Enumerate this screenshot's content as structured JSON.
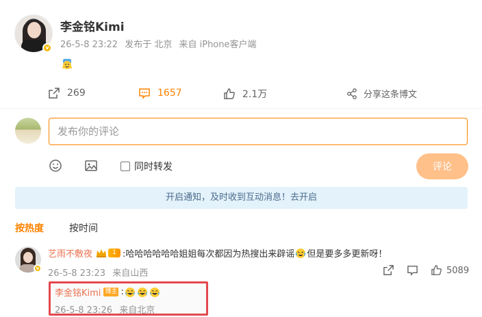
{
  "post": {
    "author": "李金铭Kimi",
    "time": "26-5-8 23:22",
    "location": "发布于 北京",
    "source": "来自 iPhone客户端"
  },
  "actions": {
    "repost_count": "269",
    "comment_count": "1657",
    "like_count": "2.1万",
    "share_label": "分享这条博文"
  },
  "composer": {
    "placeholder": "发布你的评论",
    "repost_label": "同时转发",
    "submit_label": "评论"
  },
  "notice": "开启通知，及时收到互动消息！去开启",
  "sort_tabs": [
    "按热度",
    "按时间"
  ],
  "comment": {
    "user": "艺雨不敷夜",
    "level": "1",
    "text_part1": ":哈哈哈哈哈哈姐姐每次都因为热搜出来辟谣",
    "text_part2": "但是要多多更新呀！",
    "time": "26-5-8 23:23",
    "source": "来自山西",
    "like_count": "5089"
  },
  "reply": {
    "user": "李金铭Kimi",
    "badge": "博主",
    "colon": ":",
    "time": "26-5-8 23:26",
    "source": "来自北京"
  },
  "colors": {
    "accent": "#ff8200",
    "username": "#eb7350",
    "highlight_box": "#e3484e",
    "notice_bg": "#e3f2fb"
  }
}
